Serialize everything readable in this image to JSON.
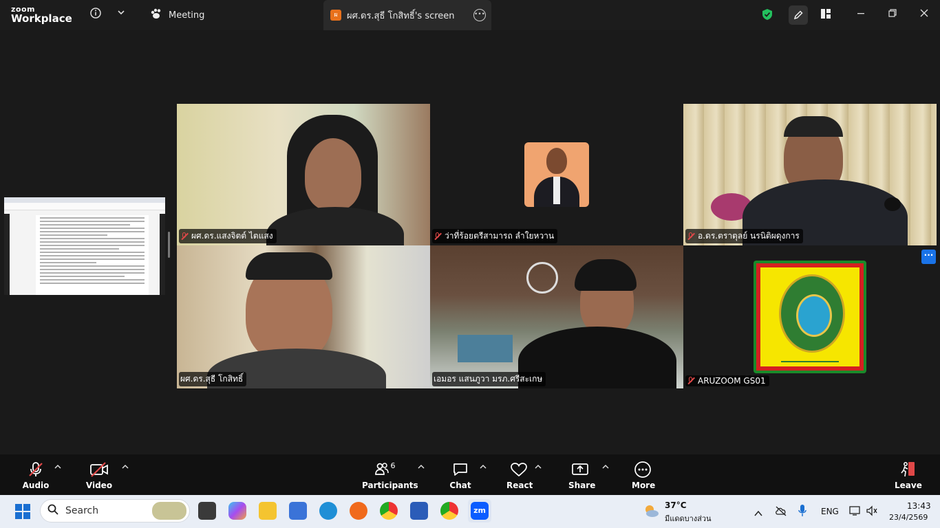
{
  "app": {
    "brand_top": "zoom",
    "brand_bottom": "Workplace"
  },
  "tabs": {
    "meeting": "Meeting",
    "screen": "ผศ.ดร.สุธี โกสิทธิ์'s screen",
    "screen_badge": "ผ"
  },
  "participants": [
    {
      "name": "ผศ.ดร.แสงจิตต์  ไตแสง"
    },
    {
      "name": "ว่าที่ร้อยตรีสามารถ ลำใยหวาน"
    },
    {
      "name": "อ.ดร.ตราตุลย์ นรนิติผดุงการ"
    },
    {
      "name": "ผศ.ดร.สุธี  โกสิทธิ์"
    },
    {
      "name": "เอมอร แสนภูวา มรภ.ศรีสะเกษ"
    },
    {
      "name": "ARUZOOM GS01"
    }
  ],
  "toolbar": {
    "audio": "Audio",
    "video": "Video",
    "participants": "Participants",
    "participants_count": "6",
    "chat": "Chat",
    "react": "React",
    "share": "Share",
    "more": "More",
    "leave": "Leave"
  },
  "taskbar": {
    "search_placeholder": "Search",
    "weather_temp": "37°C",
    "weather_desc": "มีแดดบางส่วน",
    "lang": "ENG",
    "time": "13:43",
    "date": "23/4/2569"
  },
  "colors": {
    "active_speaker": "#34c97a",
    "muted": "#e04848",
    "accent": "#1a73e8",
    "leave": "#e04848"
  },
  "icons": [
    "info-icon",
    "chevron-down-icon",
    "meeting-icon",
    "shield-icon",
    "pencil-icon",
    "layout-icon",
    "minimize-icon",
    "restore-icon",
    "close-icon",
    "mic-muted-icon",
    "video-muted-icon",
    "participants-icon",
    "chat-icon",
    "heart-icon",
    "share-icon",
    "more-icon",
    "leave-icon",
    "windows-icon",
    "search-icon"
  ]
}
